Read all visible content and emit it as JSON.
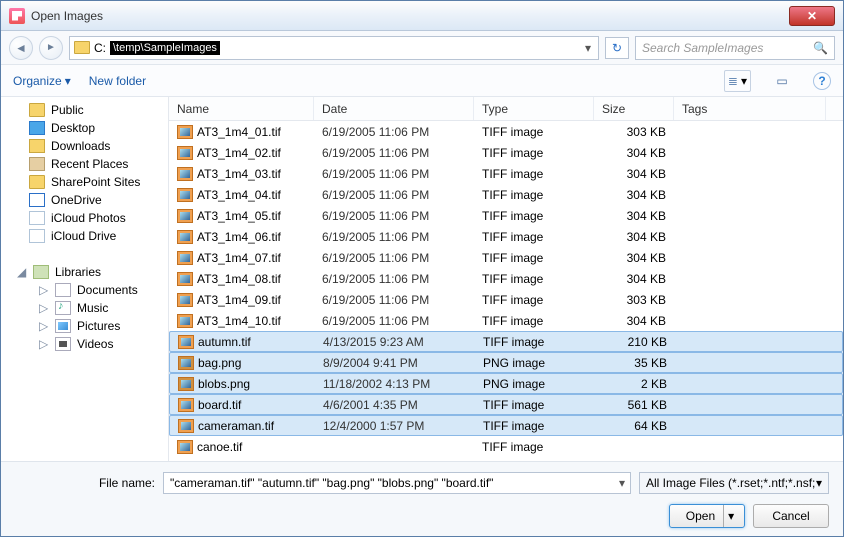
{
  "window": {
    "title": "Open Images"
  },
  "address": {
    "path_prefix": "C:",
    "path_highlight": "\\temp\\SampleImages",
    "search_placeholder": "Search SampleImages"
  },
  "toolbar": {
    "organize": "Organize",
    "new_folder": "New folder"
  },
  "sidebar_top": [
    {
      "label": "Public",
      "icon": "ic-folder"
    },
    {
      "label": "Desktop",
      "icon": "ic-desktop"
    },
    {
      "label": "Downloads",
      "icon": "ic-dl"
    },
    {
      "label": "Recent Places",
      "icon": "ic-recent"
    },
    {
      "label": "SharePoint Sites",
      "icon": "ic-folder"
    },
    {
      "label": "OneDrive",
      "icon": "ic-od"
    },
    {
      "label": "iCloud Photos",
      "icon": "ic-icp"
    },
    {
      "label": "iCloud Drive",
      "icon": "ic-icd"
    }
  ],
  "sidebar_libraries_label": "Libraries",
  "sidebar_libraries": [
    {
      "label": "Documents",
      "icon": "ic-doc"
    },
    {
      "label": "Music",
      "icon": "ic-mus"
    },
    {
      "label": "Pictures",
      "icon": "ic-pic"
    },
    {
      "label": "Videos",
      "icon": "ic-vid"
    }
  ],
  "columns": {
    "name": "Name",
    "date": "Date",
    "type": "Type",
    "size": "Size",
    "tags": "Tags"
  },
  "files": [
    {
      "name": "AT3_1m4_01.tif",
      "date": "6/19/2005 11:06 PM",
      "type": "TIFF image",
      "size": "303 KB",
      "selected": false,
      "ext": "tif"
    },
    {
      "name": "AT3_1m4_02.tif",
      "date": "6/19/2005 11:06 PM",
      "type": "TIFF image",
      "size": "304 KB",
      "selected": false,
      "ext": "tif"
    },
    {
      "name": "AT3_1m4_03.tif",
      "date": "6/19/2005 11:06 PM",
      "type": "TIFF image",
      "size": "304 KB",
      "selected": false,
      "ext": "tif"
    },
    {
      "name": "AT3_1m4_04.tif",
      "date": "6/19/2005 11:06 PM",
      "type": "TIFF image",
      "size": "304 KB",
      "selected": false,
      "ext": "tif"
    },
    {
      "name": "AT3_1m4_05.tif",
      "date": "6/19/2005 11:06 PM",
      "type": "TIFF image",
      "size": "304 KB",
      "selected": false,
      "ext": "tif"
    },
    {
      "name": "AT3_1m4_06.tif",
      "date": "6/19/2005 11:06 PM",
      "type": "TIFF image",
      "size": "304 KB",
      "selected": false,
      "ext": "tif"
    },
    {
      "name": "AT3_1m4_07.tif",
      "date": "6/19/2005 11:06 PM",
      "type": "TIFF image",
      "size": "304 KB",
      "selected": false,
      "ext": "tif"
    },
    {
      "name": "AT3_1m4_08.tif",
      "date": "6/19/2005 11:06 PM",
      "type": "TIFF image",
      "size": "304 KB",
      "selected": false,
      "ext": "tif"
    },
    {
      "name": "AT3_1m4_09.tif",
      "date": "6/19/2005 11:06 PM",
      "type": "TIFF image",
      "size": "303 KB",
      "selected": false,
      "ext": "tif"
    },
    {
      "name": "AT3_1m4_10.tif",
      "date": "6/19/2005 11:06 PM",
      "type": "TIFF image",
      "size": "304 KB",
      "selected": false,
      "ext": "tif"
    },
    {
      "name": "autumn.tif",
      "date": "4/13/2015 9:23 AM",
      "type": "TIFF image",
      "size": "210 KB",
      "selected": true,
      "ext": "tif"
    },
    {
      "name": "bag.png",
      "date": "8/9/2004 9:41 PM",
      "type": "PNG image",
      "size": "35 KB",
      "selected": true,
      "ext": "png"
    },
    {
      "name": "blobs.png",
      "date": "11/18/2002 4:13 PM",
      "type": "PNG image",
      "size": "2 KB",
      "selected": true,
      "ext": "png"
    },
    {
      "name": "board.tif",
      "date": "4/6/2001 4:35 PM",
      "type": "TIFF image",
      "size": "561 KB",
      "selected": true,
      "ext": "tif"
    },
    {
      "name": "cameraman.tif",
      "date": "12/4/2000 1:57 PM",
      "type": "TIFF image",
      "size": "64 KB",
      "selected": true,
      "ext": "tif"
    },
    {
      "name": "canoe.tif",
      "date": "",
      "type": "TIFF image",
      "size": "",
      "selected": false,
      "ext": "tif"
    }
  ],
  "footer": {
    "filename_label": "File name:",
    "filename_value": "\"cameraman.tif\" \"autumn.tif\" \"bag.png\" \"blobs.png\" \"board.tif\"",
    "filter_label": "All Image Files (*.rset;*.ntf;*.nsf;",
    "open_label": "Open",
    "cancel_label": "Cancel"
  }
}
